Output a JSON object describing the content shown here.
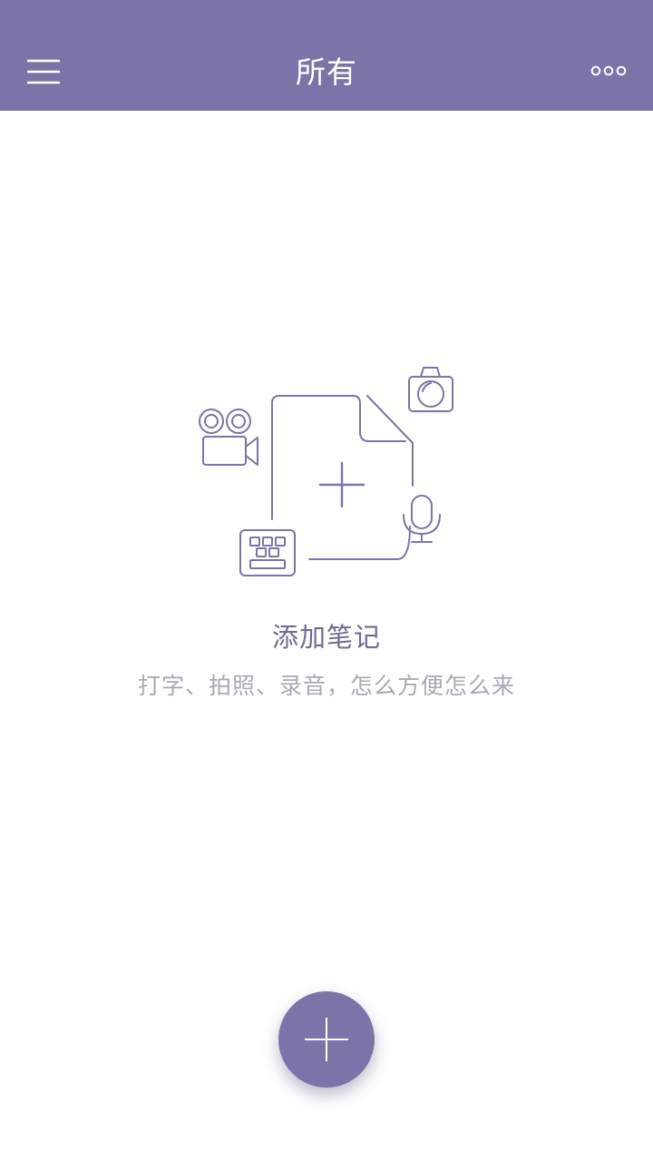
{
  "colors": {
    "header_background": "#7c74a8",
    "header_text": "#ffffff",
    "illustration_stroke": "#7c74a8",
    "empty_title": "#6f6a92",
    "empty_subtitle": "#a9a8b6",
    "fab_background": "#7c74a8"
  },
  "header": {
    "title": "所有",
    "menu_icon": "hamburger-menu-icon",
    "more_icon": "more-dots-icon"
  },
  "empty_state": {
    "title": "添加笔记",
    "subtitle": "打字、拍照、录音，怎么方便怎么来",
    "illustration_icons": [
      "video-camera-icon",
      "new-note-document-icon",
      "photo-camera-icon",
      "microphone-icon",
      "keyboard-icon"
    ]
  },
  "fab": {
    "icon": "plus-icon"
  }
}
